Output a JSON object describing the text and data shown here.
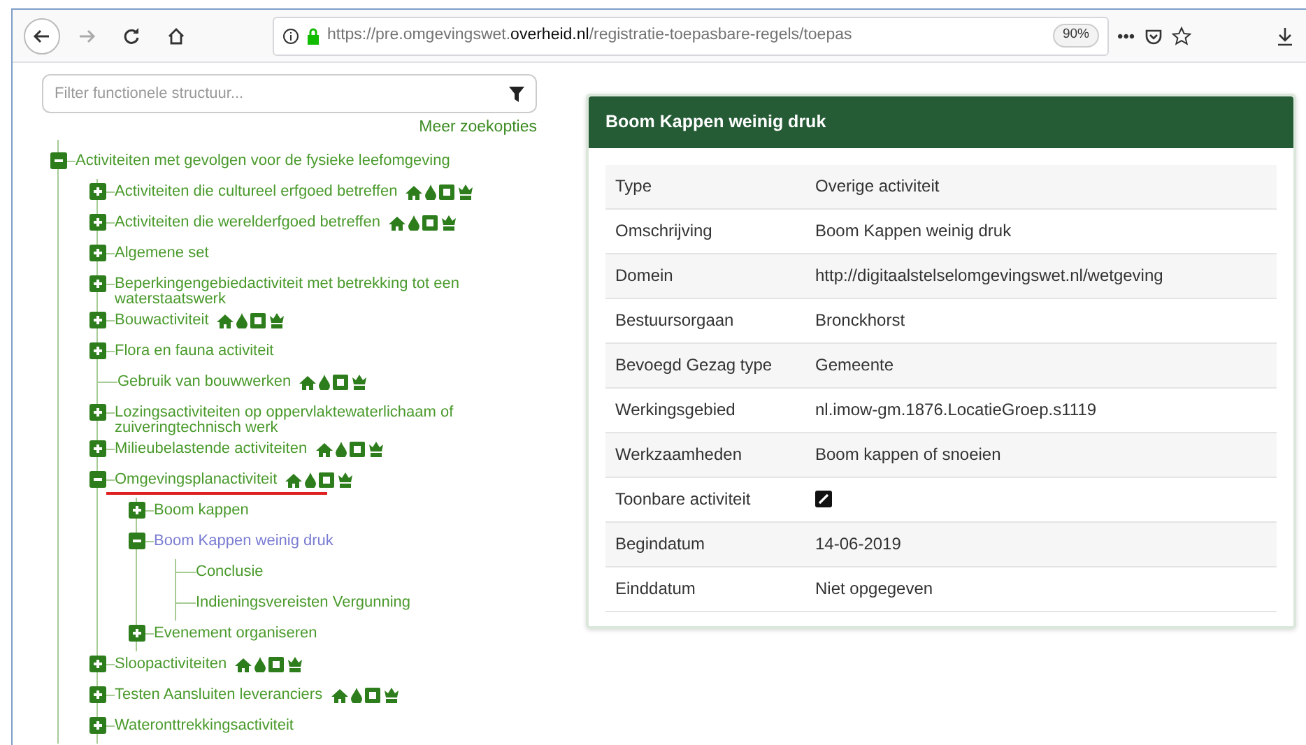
{
  "browser": {
    "url": "https://pre.omgevingswet.**overheid.nl**/registratie-toepasbare-regels/toepas",
    "zoom": "90%",
    "menu": "•••"
  },
  "filter": {
    "placeholder": "Filter functionele structuur...",
    "more_link": "Meer zoekopties"
  },
  "tree": [
    {
      "label": "Activiteiten met gevolgen voor de fysieke leefomgeving",
      "kind": "branch",
      "expanded": true,
      "icons": false,
      "selected": false,
      "annotated": false,
      "children": [
        {
          "label": "Activiteiten die cultureel erfgoed betreffen",
          "kind": "branch",
          "expanded": false,
          "icons": true,
          "selected": false,
          "annotated": false
        },
        {
          "label": "Activiteiten die werelderfgoed betreffen",
          "kind": "branch",
          "expanded": false,
          "icons": true,
          "selected": false,
          "annotated": false
        },
        {
          "label": "Algemene set",
          "kind": "branch",
          "expanded": false,
          "icons": false,
          "selected": false,
          "annotated": false
        },
        {
          "label": "Beperkingengebiedactiviteit met betrekking tot een waterstaatswerk",
          "kind": "branch",
          "expanded": false,
          "icons": false,
          "selected": false,
          "annotated": false
        },
        {
          "label": "Bouwactiviteit",
          "kind": "branch",
          "expanded": false,
          "icons": true,
          "selected": false,
          "annotated": false
        },
        {
          "label": "Flora en fauna activiteit",
          "kind": "branch",
          "expanded": false,
          "icons": false,
          "selected": false,
          "annotated": false
        },
        {
          "label": "Gebruik van bouwwerken",
          "kind": "leaf",
          "icons": true,
          "selected": false,
          "annotated": false
        },
        {
          "label": "Lozingsactiviteiten op oppervlaktewaterlichaam of zuiveringtechnisch werk",
          "kind": "branch",
          "expanded": false,
          "icons": false,
          "selected": false,
          "annotated": false
        },
        {
          "label": "Milieubelastende activiteiten",
          "kind": "branch",
          "expanded": false,
          "icons": true,
          "selected": false,
          "annotated": false
        },
        {
          "label": "Omgevingsplanactiviteit",
          "kind": "branch",
          "expanded": true,
          "icons": true,
          "selected": false,
          "annotated": true,
          "children": [
            {
              "label": "Boom kappen",
              "kind": "branch",
              "expanded": false,
              "icons": false,
              "selected": false,
              "annotated": false
            },
            {
              "label": "Boom Kappen weinig druk",
              "kind": "branch",
              "expanded": true,
              "icons": false,
              "selected": true,
              "annotated": false,
              "children": [
                {
                  "label": "Conclusie",
                  "kind": "leaf",
                  "icons": false,
                  "selected": false,
                  "annotated": false
                },
                {
                  "label": "Indieningsvereisten Vergunning",
                  "kind": "leaf",
                  "icons": false,
                  "selected": false,
                  "annotated": false
                }
              ]
            },
            {
              "label": "Evenement organiseren",
              "kind": "branch",
              "expanded": false,
              "icons": false,
              "selected": false,
              "annotated": false
            }
          ]
        },
        {
          "label": "Sloopactiviteiten",
          "kind": "branch",
          "expanded": false,
          "icons": true,
          "selected": false,
          "annotated": false
        },
        {
          "label": "Testen Aansluiten leveranciers",
          "kind": "branch",
          "expanded": false,
          "icons": true,
          "selected": false,
          "annotated": false
        },
        {
          "label": "Wateronttrekkingsactiviteit",
          "kind": "branch",
          "expanded": false,
          "icons": false,
          "selected": false,
          "annotated": false
        }
      ]
    }
  ],
  "detail": {
    "title": "Boom Kappen weinig druk",
    "rows": [
      {
        "kind": "text",
        "label": "Type",
        "value": "Overige activiteit"
      },
      {
        "kind": "text",
        "label": "Omschrijving",
        "value": "Boom Kappen weinig druk"
      },
      {
        "kind": "text",
        "label": "Domein",
        "value": "http://digitaalstelselomgevingswet.nl/wetgeving"
      },
      {
        "kind": "text",
        "label": "Bestuursorgaan",
        "value": "Bronckhorst"
      },
      {
        "kind": "text",
        "label": "Bevoegd Gezag type",
        "value": "Gemeente"
      },
      {
        "kind": "text",
        "label": "Werkingsgebied",
        "value": "nl.imow-gm.1876.LocatieGroep.s1119"
      },
      {
        "kind": "text",
        "label": "Werkzaamheden",
        "value": "Boom kappen of snoeien"
      },
      {
        "kind": "checkbox",
        "label": "Toonbare activiteit",
        "checked": true
      },
      {
        "kind": "text",
        "label": "Begindatum",
        "value": "14-06-2019"
      },
      {
        "kind": "text",
        "label": "Einddatum",
        "value": "Niet opgegeven"
      }
    ]
  }
}
